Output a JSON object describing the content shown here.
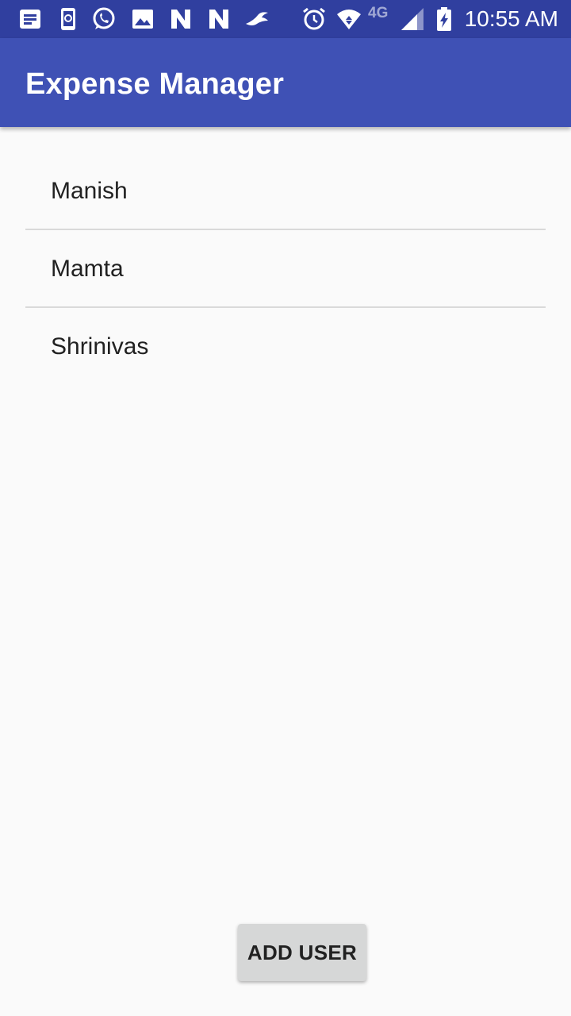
{
  "status_bar": {
    "icons": [
      "message-icon",
      "phone-sync-icon",
      "whatsapp-icon",
      "image-icon",
      "n-app-icon",
      "n-app-icon",
      "bird-icon",
      "alarm-icon",
      "wifi-icon",
      "signal-icon",
      "battery-charging-icon"
    ],
    "network_label": "4G",
    "time": "10:55 AM",
    "background_color": "#303f9f"
  },
  "app_bar": {
    "title": "Expense Manager",
    "background_color": "#3f51b5"
  },
  "users": [
    {
      "name": "Manish"
    },
    {
      "name": "Mamta"
    },
    {
      "name": "Shrinivas"
    }
  ],
  "add_user_button": {
    "label": "ADD USER"
  }
}
